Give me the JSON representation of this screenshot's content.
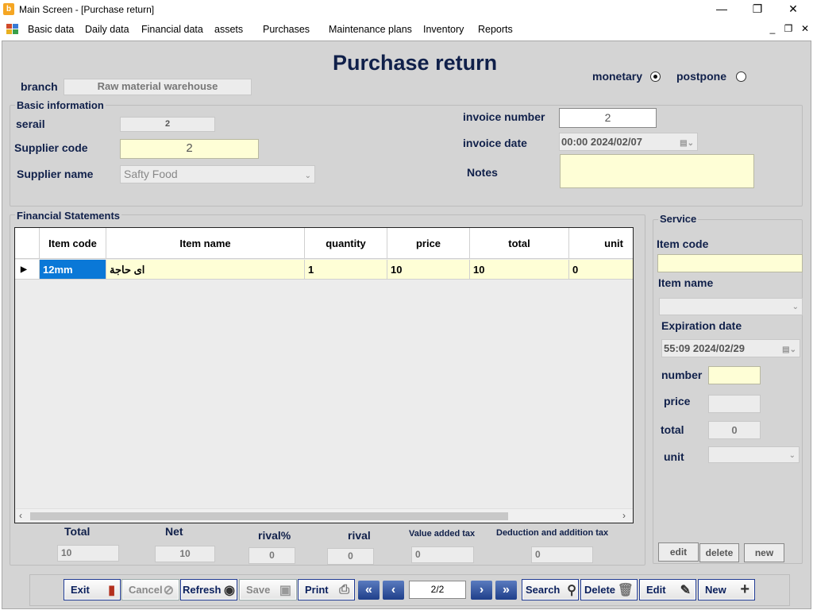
{
  "window": {
    "title": "Main Screen - [Purchase return]",
    "controls": {
      "minimize": "—",
      "maximize": "❐",
      "close": "✕"
    }
  },
  "menu": {
    "items": [
      "Basic data",
      "Daily data",
      "Financial data",
      "assets",
      "Purchases",
      "Maintenance plans",
      "Inventory",
      "Reports"
    ],
    "mdi": {
      "minimize": "_",
      "restore": "❐",
      "close": "✕"
    }
  },
  "header": {
    "title": "Purchase return",
    "branch_label": "branch",
    "branch_value": "Raw material warehouse",
    "payment": {
      "monetary": "monetary",
      "postpone": "postpone",
      "selected": "monetary"
    }
  },
  "basic": {
    "title": "Basic information",
    "serial_label": "serail",
    "serial_value": "2",
    "supplier_code_label": "Supplier code",
    "supplier_code_value": "2",
    "supplier_name_label": "Supplier name",
    "supplier_name_value": "Safty Food",
    "invoice_number_label": "invoice number",
    "invoice_number_value": "2",
    "invoice_date_label": "invoice date",
    "invoice_date_value": "00:00 2024/02/07",
    "notes_label": "Notes",
    "notes_value": ""
  },
  "financial": {
    "title": "Financial Statements",
    "columns": [
      "Item code",
      "Item name",
      "quantity",
      "price",
      "total",
      "unit"
    ],
    "rows": [
      {
        "code": "12mm",
        "name": "اى حاجة",
        "quantity": "1",
        "price": "10",
        "total": "10",
        "unit": "0"
      }
    ]
  },
  "totals": {
    "total_label": "Total",
    "total_value": "10",
    "net_label": "Net",
    "net_value": "10",
    "rival_pct_label": "rival%",
    "rival_pct_value": "0",
    "rival_label": "rival",
    "rival_value": "0",
    "vat_label": "Value added tax",
    "vat_value": "0",
    "deduction_label": "Deduction and addition tax",
    "deduction_value": "0"
  },
  "service": {
    "title": "Service",
    "item_code_label": "Item code",
    "item_code_value": "",
    "item_name_label": "Item name",
    "expiration_label": "Expiration date",
    "expiration_value": "55:09 2024/02/29",
    "number_label": "number",
    "price_label": "price",
    "total_label": "total",
    "total_value": "0",
    "unit_label": "unit",
    "edit": "edit",
    "delete": "delete",
    "new": "new"
  },
  "toolbar": {
    "exit": "Exit",
    "cancel": "Cancel",
    "refresh": "Refresh",
    "save": "Save",
    "print": "Print",
    "page": "2/2",
    "search": "Search",
    "delete": "Delete",
    "edit": "Edit",
    "new": "New"
  }
}
